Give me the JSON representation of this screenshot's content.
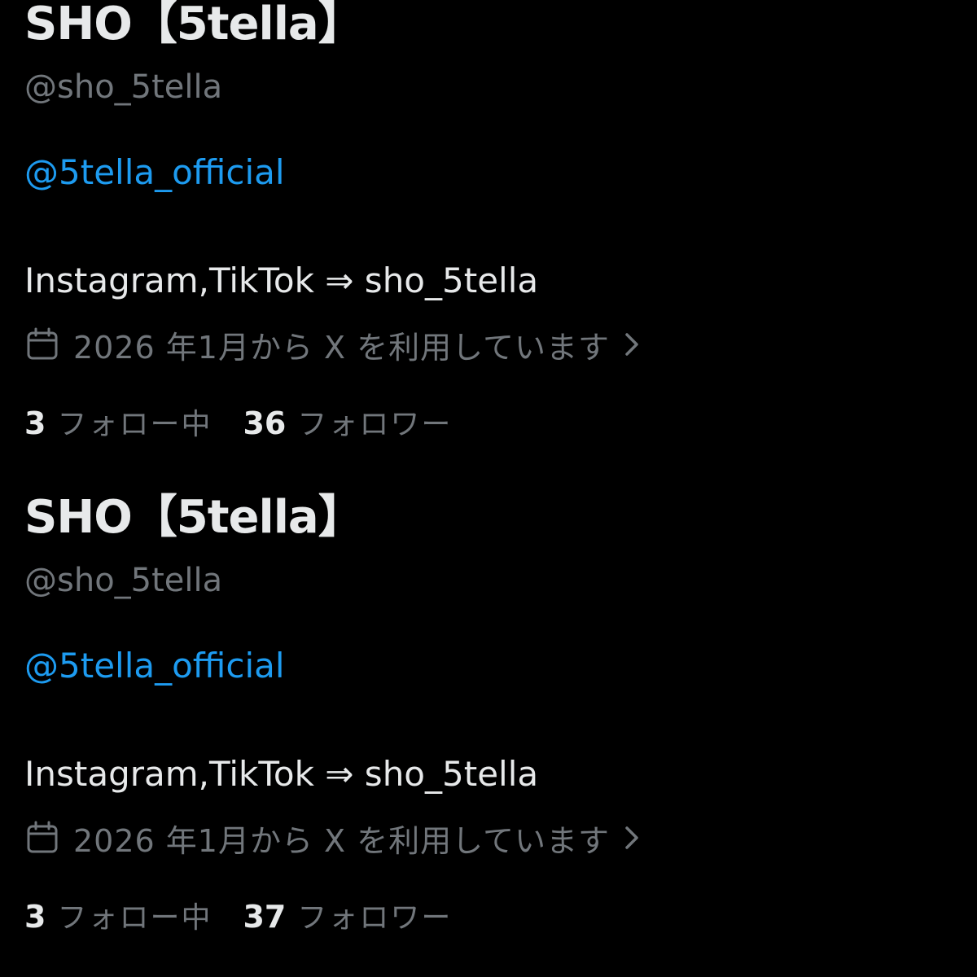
{
  "profiles": [
    {
      "display_name": "SHO【5tella】",
      "handle": "@sho_5tella",
      "mention": "@5tella_official",
      "bio": "Instagram,TikTok ⇒ sho_5tella",
      "joined": "2026 年1月から X を利用しています",
      "following_count": "3",
      "following_label": "フォロー中",
      "followers_count": "36",
      "followers_label": "フォロワー"
    },
    {
      "display_name": "SHO【5tella】",
      "handle": "@sho_5tella",
      "mention": "@5tella_official",
      "bio": "Instagram,TikTok ⇒ sho_5tella",
      "joined": "2026 年1月から X を利用しています",
      "following_count": "3",
      "following_label": "フォロー中",
      "followers_count": "37",
      "followers_label": "フォロワー"
    }
  ],
  "icons": {
    "calendar": "calendar-icon",
    "chevron": "chevron-right-icon"
  },
  "colors": {
    "background": "#000000",
    "primary_text": "#e7e9ea",
    "secondary_text": "#71767b",
    "link": "#1d9bf0"
  }
}
